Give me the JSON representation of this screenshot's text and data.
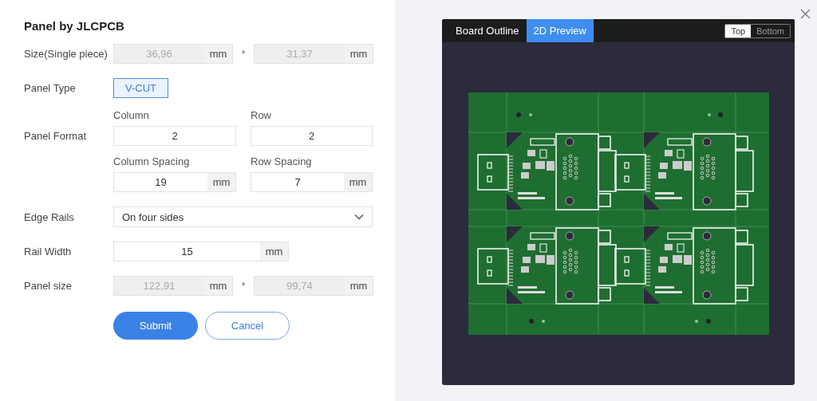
{
  "dialog": {
    "title": "Panel by JLCPCB"
  },
  "size": {
    "label": "Size(Single piece)",
    "disabled": true,
    "separator": "*",
    "values": [
      {
        "value": "36,96",
        "unit": "mm"
      },
      {
        "value": "31,37",
        "unit": "mm"
      }
    ]
  },
  "panel_type": {
    "label": "Panel Type",
    "options": [
      {
        "label": "V-CUT",
        "selected": true
      }
    ]
  },
  "panel_format": {
    "label": "Panel Format",
    "column": {
      "label": "Column",
      "value": "2"
    },
    "row": {
      "label": "Row",
      "value": "2"
    },
    "column_spacing": {
      "label": "Column Spacing",
      "value": "19",
      "unit": "mm"
    },
    "row_spacing": {
      "label": "Row Spacing",
      "value": "7",
      "unit": "mm"
    }
  },
  "edge_rails": {
    "label": "Edge Rails",
    "value": "On four sides"
  },
  "rail_width": {
    "label": "Rail Width",
    "value": "15",
    "unit": "mm"
  },
  "panel_size": {
    "label": "Panel size",
    "disabled": true,
    "separator": "*",
    "values": [
      {
        "value": "122,91",
        "unit": "mm"
      },
      {
        "value": "99,74",
        "unit": "mm"
      }
    ]
  },
  "buttons": [
    {
      "label": "Submit",
      "kind": "primary"
    },
    {
      "label": "Cancel",
      "kind": "secondary"
    }
  ],
  "preview": {
    "tabs": [
      {
        "label": "Board Outline",
        "selected": false
      },
      {
        "label": "2D Preview",
        "selected": true
      }
    ],
    "sides": [
      {
        "label": "Top",
        "selected": true
      },
      {
        "label": "Bottom",
        "selected": false
      }
    ]
  }
}
